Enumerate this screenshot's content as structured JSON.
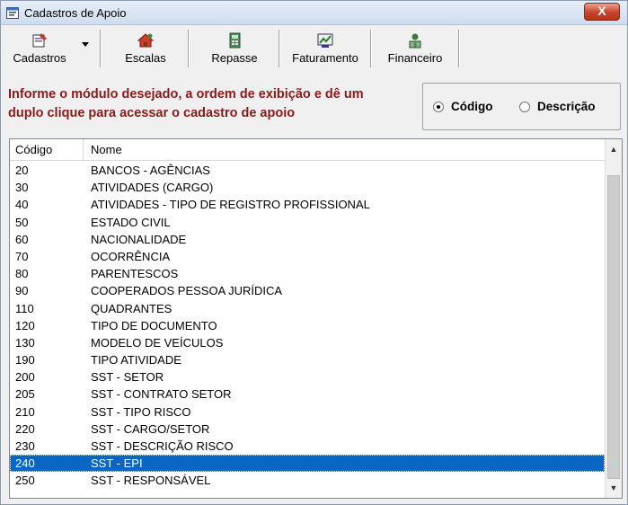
{
  "window": {
    "title": "Cadastros de Apoio",
    "close_label": "X"
  },
  "toolbar": {
    "buttons": [
      {
        "label": "Cadastros",
        "icon": "cadastros-icon"
      },
      {
        "label": "Escalas",
        "icon": "escalas-icon"
      },
      {
        "label": "Repasse",
        "icon": "repasse-icon"
      },
      {
        "label": "Faturamento",
        "icon": "faturamento-icon"
      },
      {
        "label": "Financeiro",
        "icon": "financeiro-icon"
      }
    ]
  },
  "instructions": "Informe o módulo desejado, a ordem de exibição e dê um duplo clique para acessar o cadastro de apoio",
  "order": {
    "options": [
      {
        "label": "Código",
        "checked": true
      },
      {
        "label": "Descrição",
        "checked": false
      }
    ]
  },
  "list": {
    "columns": [
      "Código",
      "Nome"
    ],
    "rows": [
      {
        "code": "20",
        "name": "BANCOS - AGÊNCIAS"
      },
      {
        "code": "30",
        "name": "ATIVIDADES (CARGO)"
      },
      {
        "code": "40",
        "name": "ATIVIDADES - TIPO DE REGISTRO PROFISSIONAL"
      },
      {
        "code": "50",
        "name": "ESTADO CIVIL"
      },
      {
        "code": "60",
        "name": "NACIONALIDADE"
      },
      {
        "code": "70",
        "name": "OCORRÊNCIA"
      },
      {
        "code": "80",
        "name": "PARENTESCOS"
      },
      {
        "code": "90",
        "name": "COOPERADOS PESSOA JURÍDICA"
      },
      {
        "code": "110",
        "name": "QUADRANTES"
      },
      {
        "code": "120",
        "name": "TIPO DE DOCUMENTO"
      },
      {
        "code": "130",
        "name": "MODELO DE VEÍCULOS"
      },
      {
        "code": "190",
        "name": "TIPO ATIVIDADE"
      },
      {
        "code": "200",
        "name": "SST - SETOR"
      },
      {
        "code": "205",
        "name": "SST - CONTRATO SETOR"
      },
      {
        "code": "210",
        "name": "SST - TIPO RISCO"
      },
      {
        "code": "220",
        "name": "SST - CARGO/SETOR"
      },
      {
        "code": "230",
        "name": "SST - DESCRIÇÃO RISCO"
      },
      {
        "code": "240",
        "name": "SST - EPI",
        "selected": true
      },
      {
        "code": "250",
        "name": "SST - RESPONSÁVEL"
      }
    ]
  },
  "colors": {
    "selection": "#0a66c2",
    "instruction_text": "#8b1a1a"
  }
}
